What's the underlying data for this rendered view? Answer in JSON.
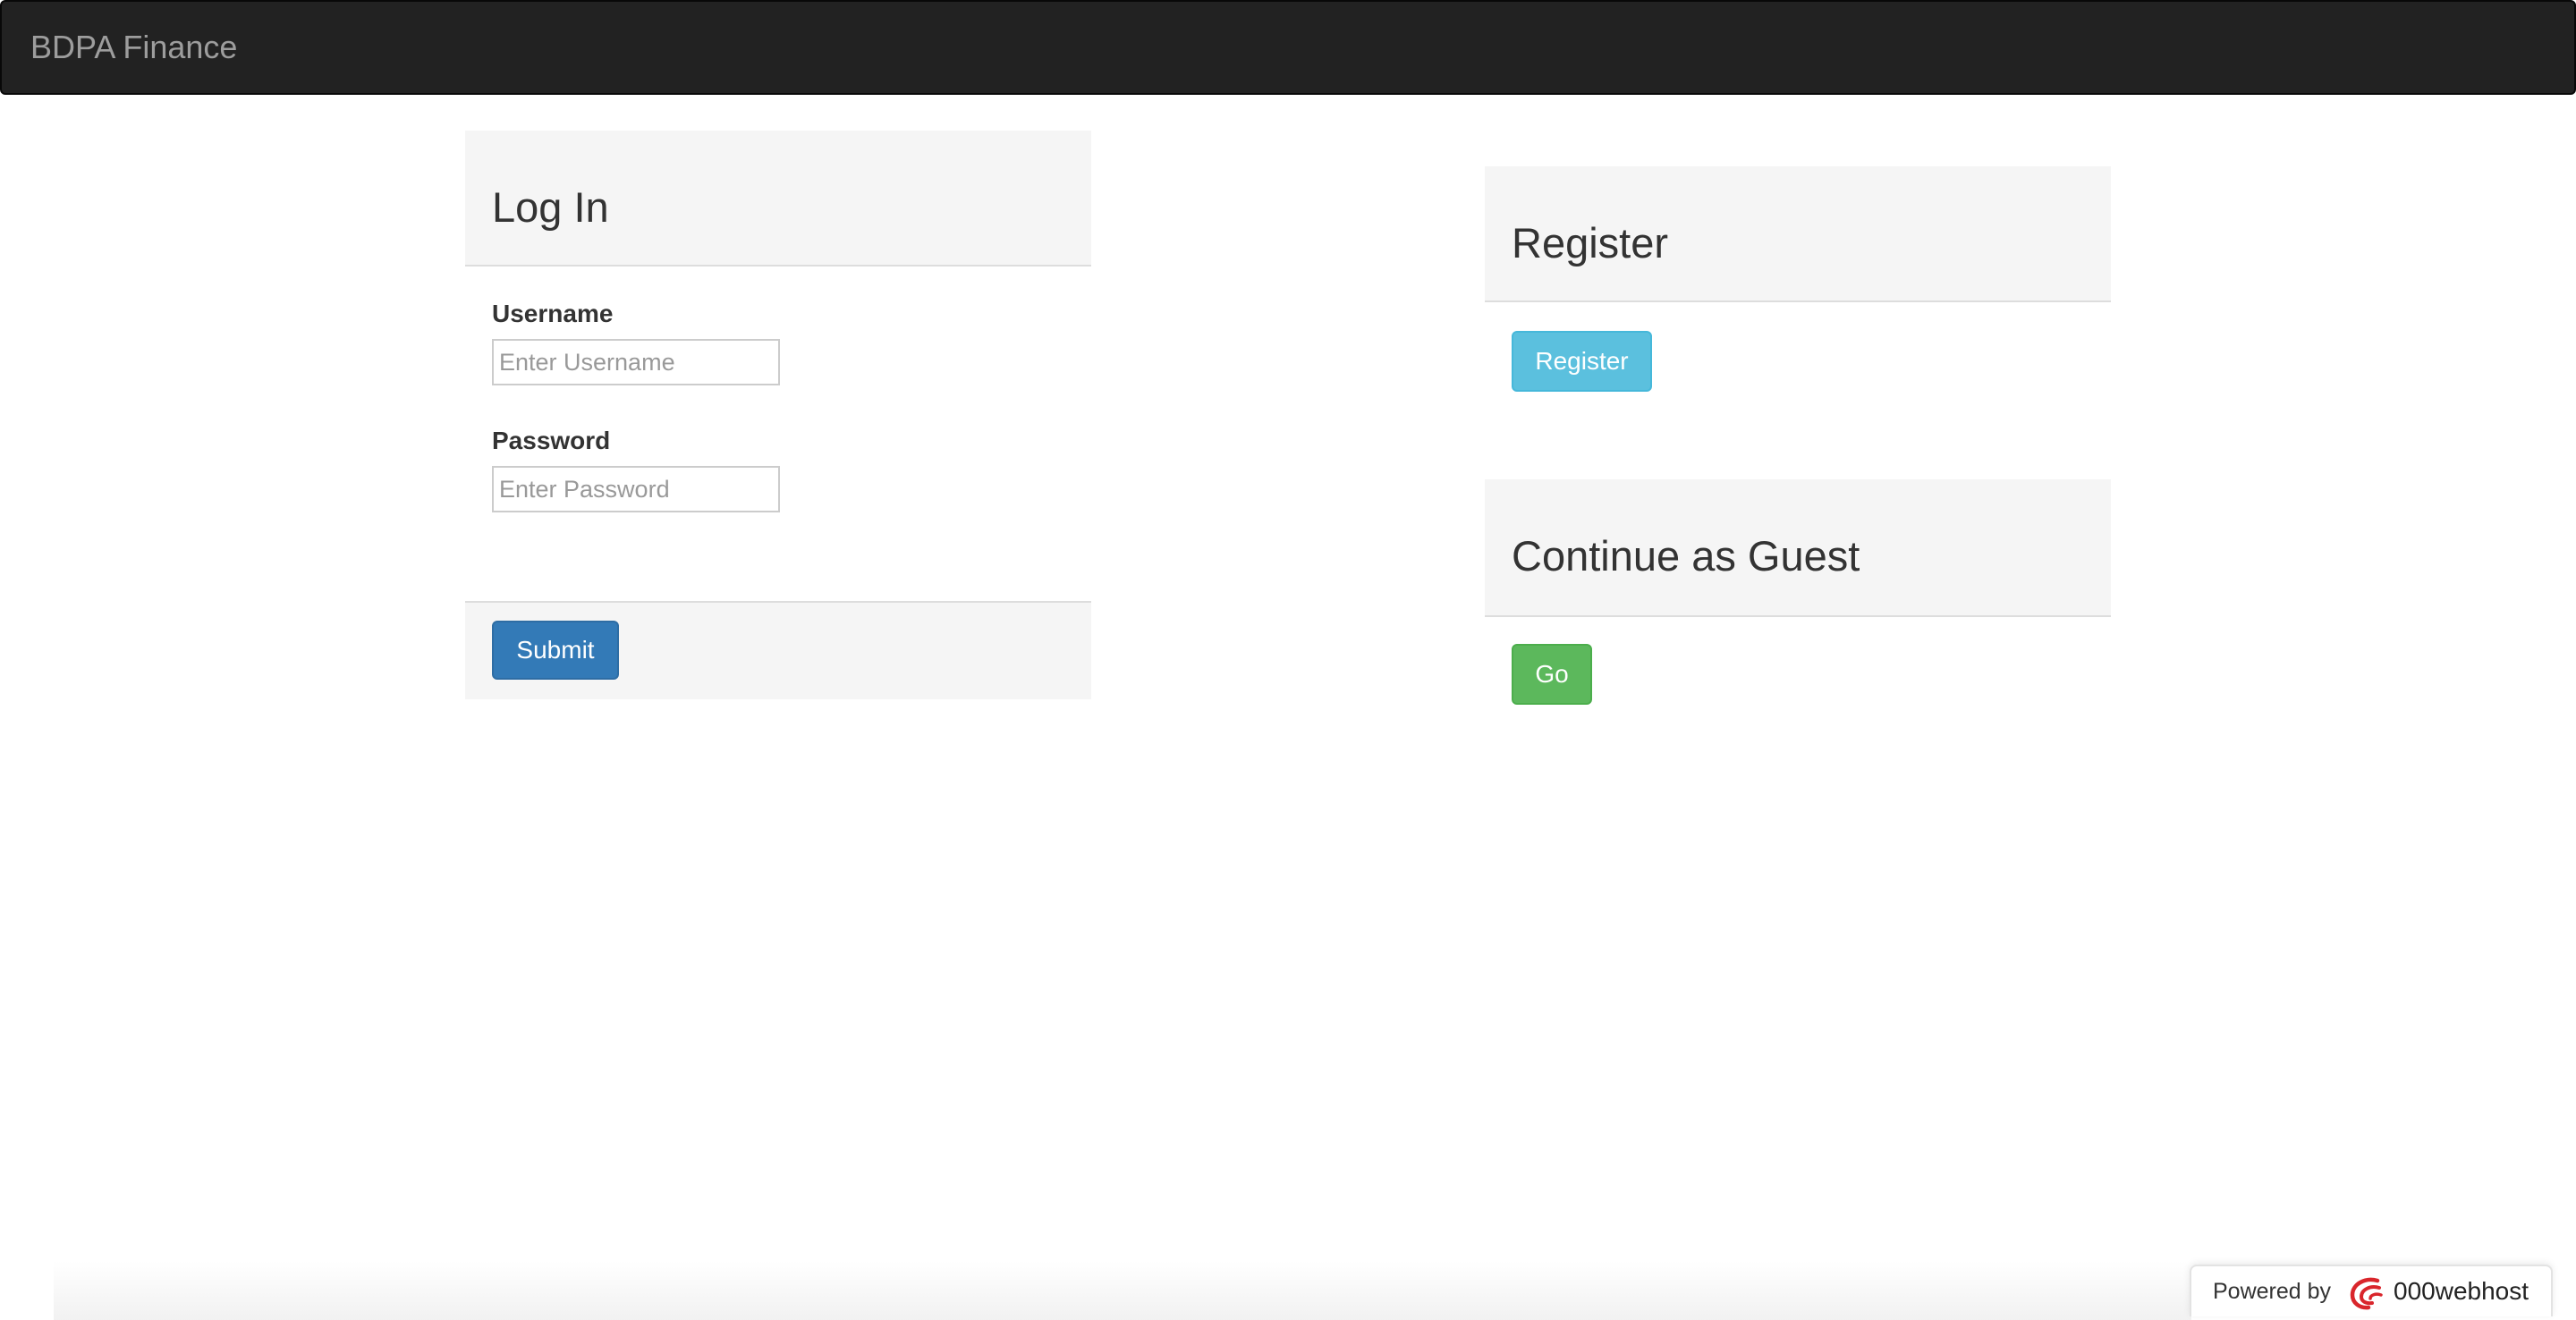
{
  "navbar": {
    "brand": "BDPA Finance"
  },
  "login": {
    "title": "Log In",
    "username_label": "Username",
    "username_placeholder": "Enter Username",
    "username_value": "",
    "password_label": "Password",
    "password_placeholder": "Enter Password",
    "password_value": "",
    "submit_label": "Submit"
  },
  "register": {
    "title": "Register",
    "button_label": "Register"
  },
  "guest": {
    "title": "Continue as Guest",
    "button_label": "Go"
  },
  "badge": {
    "powered_label": "Powered by",
    "host_name": "000webhost",
    "icon": "000webhost-logo-icon"
  },
  "colors": {
    "navbar": "#222222",
    "brand_text": "#9d9d9d",
    "primary": "#337ab7",
    "info": "#5bc0de",
    "success": "#5cb85c",
    "panel_heading": "#f5f5f5",
    "host_logo": "#d9262c"
  }
}
